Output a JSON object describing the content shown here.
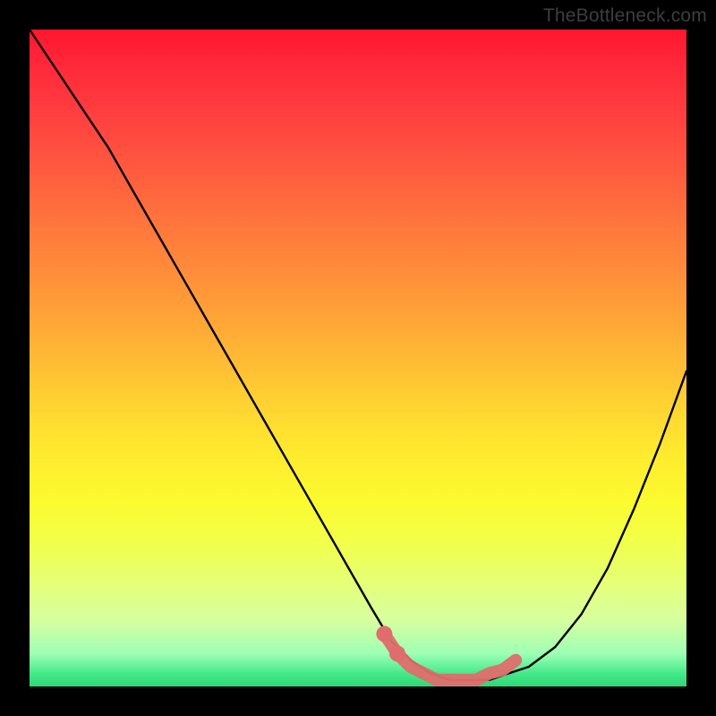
{
  "watermark": "TheBottleneck.com",
  "chart_data": {
    "type": "line",
    "title": "",
    "xlabel": "",
    "ylabel": "",
    "xlim": [
      0,
      100
    ],
    "ylim": [
      0,
      100
    ],
    "grid": false,
    "legend": false,
    "series": [
      {
        "name": "bottleneck-curve",
        "color": "#000000",
        "x": [
          0,
          4,
          8,
          12,
          16,
          20,
          24,
          28,
          32,
          36,
          40,
          44,
          48,
          52,
          55,
          58,
          61,
          64,
          67,
          70,
          73,
          76,
          80,
          84,
          88,
          92,
          96,
          100
        ],
        "y": [
          100,
          94,
          88,
          82,
          75,
          68,
          61,
          54,
          47,
          40,
          33,
          26,
          19,
          12,
          7,
          4,
          2,
          1,
          1,
          1,
          2,
          3,
          6,
          11,
          18,
          27,
          37,
          48
        ]
      },
      {
        "name": "optimal-zone-highlight",
        "color": "#e06666",
        "x": [
          54,
          56,
          58,
          60,
          62,
          64,
          66,
          68,
          70,
          72,
          74
        ],
        "y": [
          8,
          5,
          3,
          2,
          1,
          1,
          1,
          1,
          2,
          2.5,
          4
        ]
      }
    ],
    "gradient_stops": [
      {
        "pos": 0,
        "color": "#ff162f"
      },
      {
        "pos": 50,
        "color": "#ffc832"
      },
      {
        "pos": 80,
        "color": "#f5ff55"
      },
      {
        "pos": 100,
        "color": "#2cd875"
      }
    ]
  }
}
